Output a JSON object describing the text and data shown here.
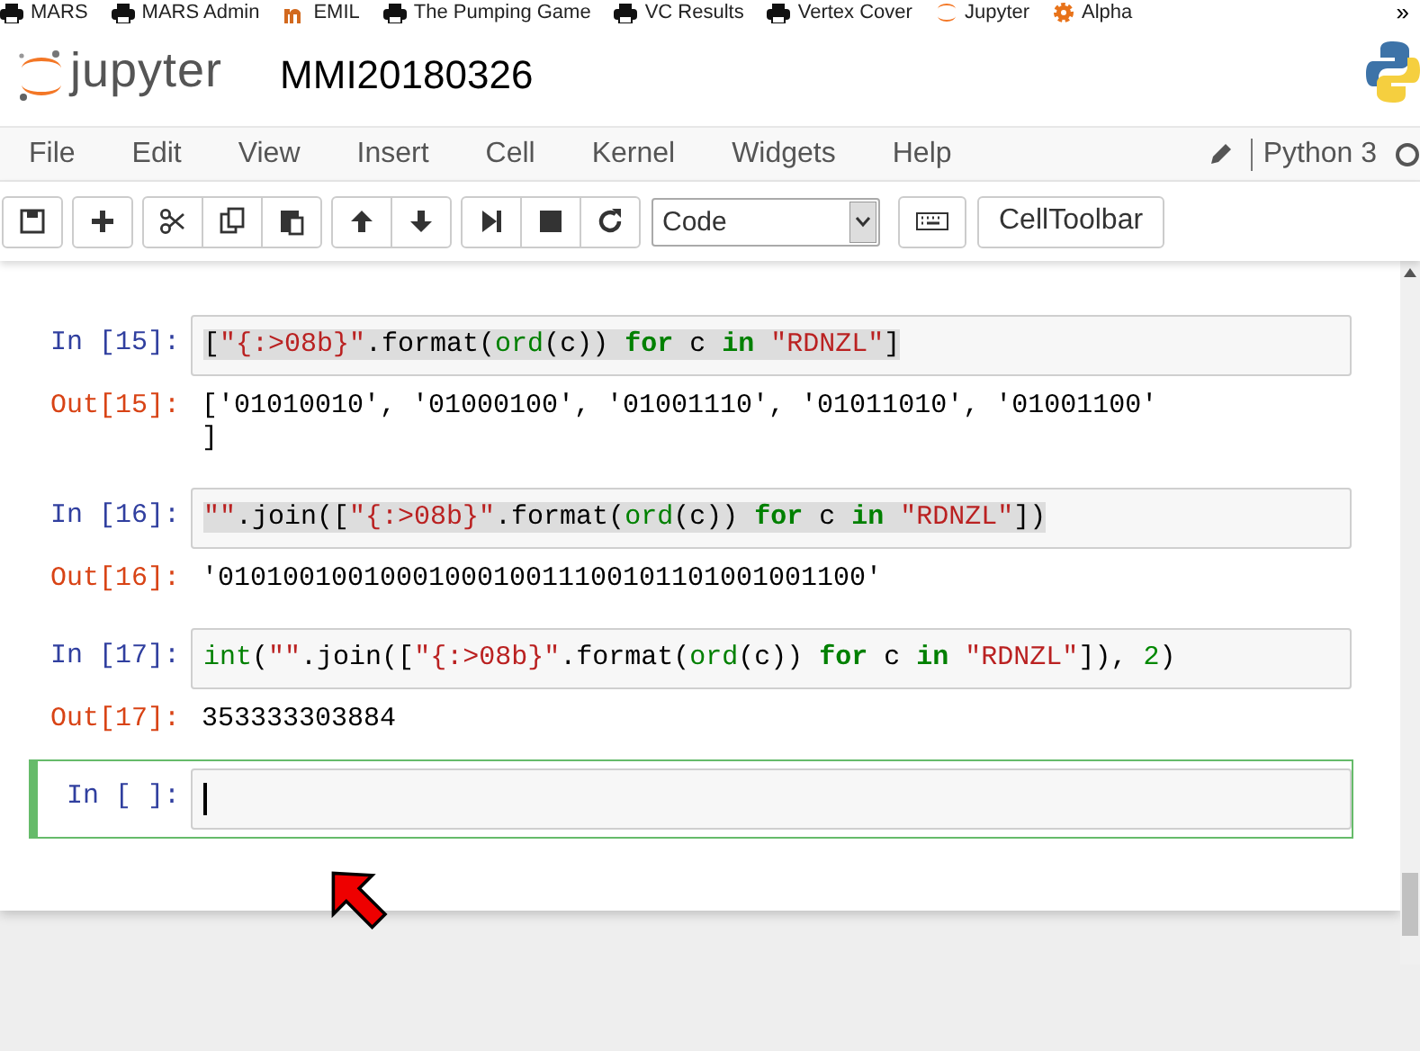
{
  "bookmarks": [
    {
      "label": "MARS",
      "kind": "printer"
    },
    {
      "label": "MARS Admin",
      "kind": "printer"
    },
    {
      "label": "EMIL",
      "kind": "m"
    },
    {
      "label": "The Pumping Game",
      "kind": "printer"
    },
    {
      "label": "VC Results",
      "kind": "printer"
    },
    {
      "label": "Vertex Cover",
      "kind": "printer"
    },
    {
      "label": "Jupyter",
      "kind": "jupyter"
    },
    {
      "label": "Alpha",
      "kind": "gear"
    }
  ],
  "bookmarks_more": "»",
  "header": {
    "logo_text": "jupyter",
    "notebook_title": "MMI20180326"
  },
  "menu": [
    "File",
    "Edit",
    "View",
    "Insert",
    "Cell",
    "Kernel",
    "Widgets",
    "Help"
  ],
  "kernel": {
    "name": "Python 3"
  },
  "toolbar": {
    "cell_type": "Code",
    "celltoolbar": "CellToolbar"
  },
  "cells": [
    {
      "prompt": "In [15]:",
      "selected": false,
      "highlighted": true,
      "code": [
        {
          "t": "[",
          "kind": "plain"
        },
        {
          "t": "\"{:>08b}\"",
          "kind": "string"
        },
        {
          "t": ".format(",
          "kind": "plain"
        },
        {
          "t": "ord",
          "kind": "builtin"
        },
        {
          "t": "(c)) ",
          "kind": "plain"
        },
        {
          "t": "for",
          "kind": "keyword"
        },
        {
          "t": " c ",
          "kind": "plain"
        },
        {
          "t": "in",
          "kind": "keyword"
        },
        {
          "t": " \"RDNZL\"",
          "kind": "string"
        },
        {
          "t": "]",
          "kind": "plain"
        }
      ],
      "out_prompt": "Out[15]:",
      "output": "['01010010', '01000100', '01001110', '01011010', '01001100'\n]"
    },
    {
      "prompt": "In [16]:",
      "selected": false,
      "highlighted": true,
      "code": [
        {
          "t": "\"\"",
          "kind": "string"
        },
        {
          "t": ".join([",
          "kind": "plain"
        },
        {
          "t": "\"{:>08b}\"",
          "kind": "string"
        },
        {
          "t": ".format(",
          "kind": "plain"
        },
        {
          "t": "ord",
          "kind": "builtin"
        },
        {
          "t": "(c)) ",
          "kind": "plain"
        },
        {
          "t": "for",
          "kind": "keyword"
        },
        {
          "t": " c ",
          "kind": "plain"
        },
        {
          "t": "in",
          "kind": "keyword"
        },
        {
          "t": " \"RDNZL\"",
          "kind": "string"
        },
        {
          "t": "])",
          "kind": "plain"
        }
      ],
      "out_prompt": "Out[16]:",
      "output": "'0101001001000100010011100101101001001100'"
    },
    {
      "prompt": "In [17]:",
      "selected": false,
      "highlighted": false,
      "code": [
        {
          "t": "int",
          "kind": "builtin"
        },
        {
          "t": "(",
          "kind": "plain"
        },
        {
          "t": "\"\"",
          "kind": "string"
        },
        {
          "t": ".join([",
          "kind": "plain"
        },
        {
          "t": "\"{:>08b}\"",
          "kind": "string"
        },
        {
          "t": ".format(",
          "kind": "plain"
        },
        {
          "t": "ord",
          "kind": "builtin"
        },
        {
          "t": "(c)) ",
          "kind": "plain"
        },
        {
          "t": "for",
          "kind": "keyword"
        },
        {
          "t": " c ",
          "kind": "plain"
        },
        {
          "t": "in",
          "kind": "keyword"
        },
        {
          "t": " \"RDNZL\"",
          "kind": "string"
        },
        {
          "t": "]), ",
          "kind": "plain"
        },
        {
          "t": "2",
          "kind": "number"
        },
        {
          "t": ")",
          "kind": "plain"
        }
      ],
      "out_prompt": "Out[17]:",
      "output": "353333303884"
    },
    {
      "prompt": "In [ ]:",
      "selected": true,
      "highlighted": false
    }
  ]
}
